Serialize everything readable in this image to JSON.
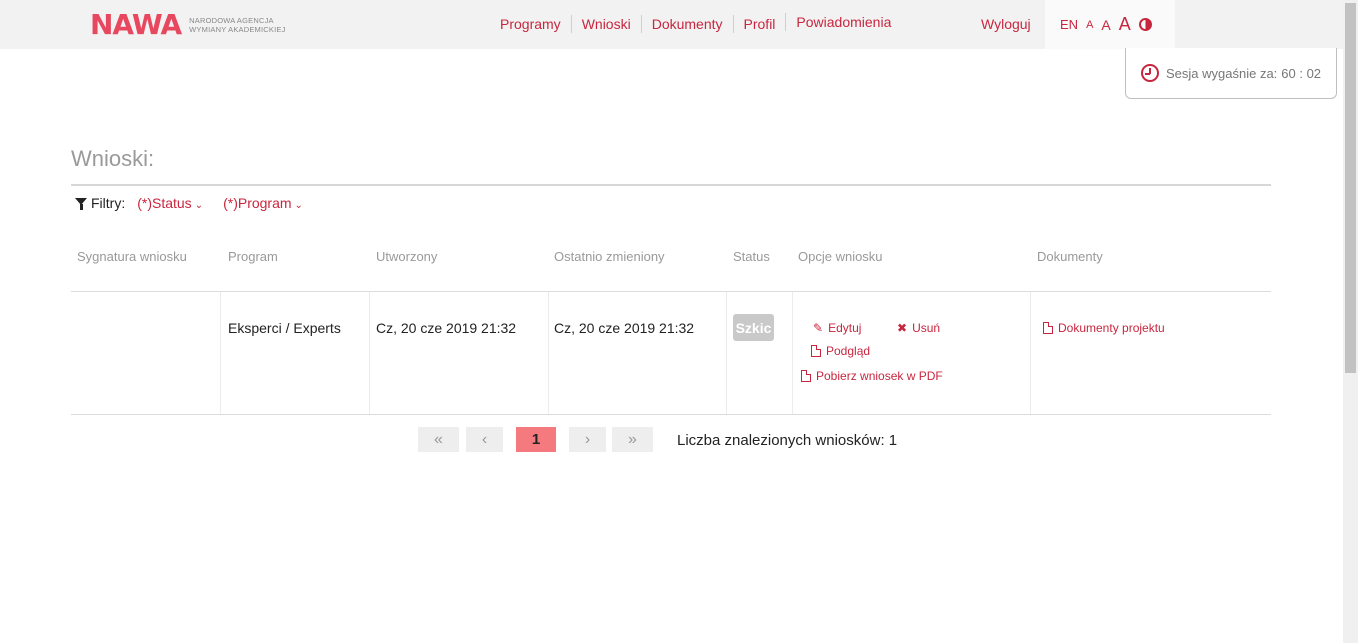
{
  "header": {
    "logo_text": "NAWA",
    "logo_sub_line1": "Narodowa Agencja",
    "logo_sub_line2": "Wymiany Akademickiej",
    "nav": [
      "Programy",
      "Wnioski",
      "Dokumenty",
      "Profil",
      "Powiadomienia"
    ],
    "logout": "Wyloguj",
    "lang": "EN",
    "font_small": "A",
    "font_medium": "A",
    "font_large": "A"
  },
  "session": {
    "label": "Sesja wygaśnie za:",
    "time": "60 : 02"
  },
  "page": {
    "title": "Wnioski:",
    "filters_label": "Filtry:",
    "filter_status": "(*)Status",
    "filter_program": "(*)Program"
  },
  "table": {
    "columns": [
      "Sygnatura wniosku",
      "Program",
      "Utworzony",
      "Ostatnio zmieniony",
      "Status",
      "Opcje wniosku",
      "Dokumenty"
    ],
    "rows": [
      {
        "signature": "",
        "program": "Eksperci / Experts",
        "created": "Cz, 20 cze 2019 21:32",
        "modified": "Cz, 20 cze 2019 21:32",
        "status": "Szkic",
        "options": {
          "edit": "Edytuj",
          "delete": "Usuń",
          "preview": "Podgląd",
          "pdf": "Pobierz wniosek w PDF"
        },
        "documents": "Dokumenty projektu"
      }
    ]
  },
  "pagination": {
    "first": "«",
    "prev": "‹",
    "current": "1",
    "next": "›",
    "last": "»",
    "count_label": "Liczba znalezionych wniosków: 1"
  },
  "colors": {
    "accent": "#c8263f",
    "logo": "#e8485f",
    "active_page": "#f47a80",
    "badge": "#c9c9c9"
  }
}
